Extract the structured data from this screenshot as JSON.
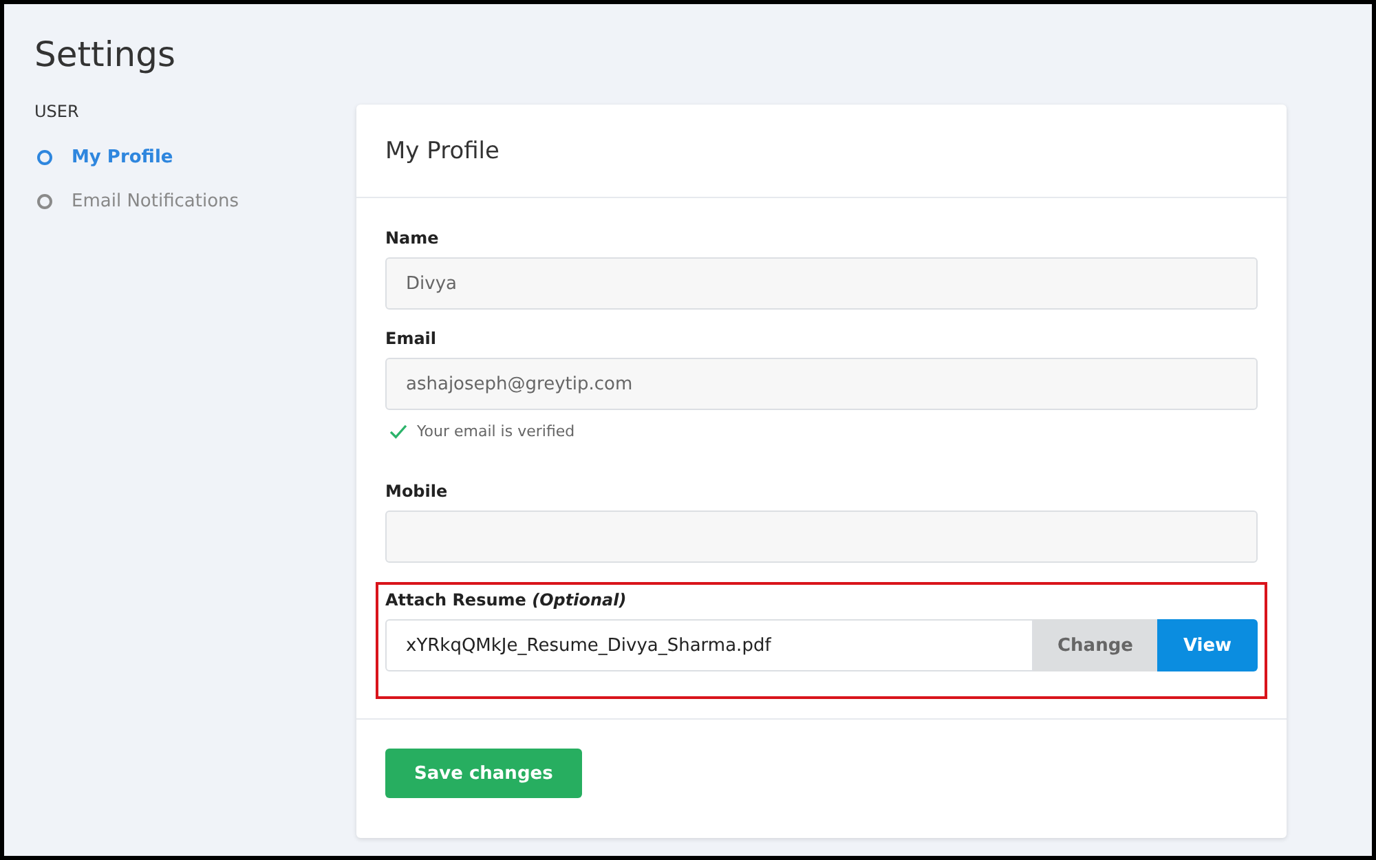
{
  "page": {
    "title": "Settings"
  },
  "sidebar": {
    "section": "USER",
    "items": [
      {
        "label": "My Profile",
        "selected": true
      },
      {
        "label": "Email Notifications",
        "selected": false
      }
    ]
  },
  "card": {
    "title": "My Profile",
    "fields": [
      {
        "kind": "text",
        "label": "Name",
        "value": "Divya",
        "readonly": true
      },
      {
        "kind": "text",
        "label": "Email",
        "value": "ashajoseph@greytip.com",
        "readonly": true,
        "note": "Your email is verified",
        "verified": true
      },
      {
        "kind": "text",
        "label": "Mobile",
        "readonly": true
      },
      {
        "kind": "file",
        "label": "Attach Resume *(Optional)*",
        "value": "xYRkqQMkJe_Resume_Divya_Sharma.pdf",
        "highlighted": true,
        "buttons": [
          "Change",
          "View"
        ]
      }
    ],
    "save_button": "Save changes"
  }
}
